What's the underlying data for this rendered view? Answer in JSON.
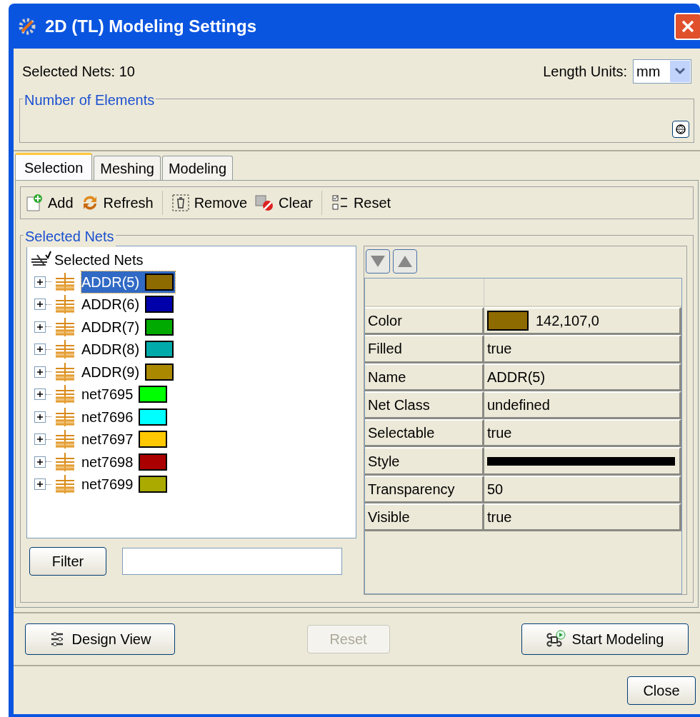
{
  "window": {
    "title": "2D (TL) Modeling Settings"
  },
  "selected_nets_label": "Selected Nets: 10",
  "length_units": {
    "label": "Length Units:",
    "value": "mm"
  },
  "number_of_elements": {
    "legend": "Number of Elements"
  },
  "tabs": [
    {
      "label": "Selection",
      "selected": true
    },
    {
      "label": "Meshing",
      "selected": false
    },
    {
      "label": "Modeling",
      "selected": false
    }
  ],
  "toolbar": [
    {
      "label": "Add",
      "kind": "add"
    },
    {
      "label": "Refresh",
      "kind": "refresh"
    },
    {
      "label": "Remove",
      "kind": "remove",
      "separator_before": true
    },
    {
      "label": "Clear",
      "kind": "clear"
    },
    {
      "label": "Reset",
      "kind": "reset",
      "separator_before": true
    }
  ],
  "selected_nets_group": {
    "legend": "Selected Nets"
  },
  "tree": {
    "root": "Selected Nets",
    "items": [
      {
        "label": "ADDR(5)",
        "color": "#8e6b00",
        "selected": true
      },
      {
        "label": "ADDR(6)",
        "color": "#0000aa",
        "selected": false
      },
      {
        "label": "ADDR(7)",
        "color": "#00aa00",
        "selected": false
      },
      {
        "label": "ADDR(8)",
        "color": "#00aaaa",
        "selected": false
      },
      {
        "label": "ADDR(9)",
        "color": "#aa8800",
        "selected": false
      },
      {
        "label": "net7695",
        "color": "#00ff00",
        "selected": false
      },
      {
        "label": "net7696",
        "color": "#00ffff",
        "selected": false
      },
      {
        "label": "net7697",
        "color": "#ffc800",
        "selected": false
      },
      {
        "label": "net7698",
        "color": "#aa0000",
        "selected": false
      },
      {
        "label": "net7699",
        "color": "#aaaa00",
        "selected": false
      }
    ]
  },
  "filter": {
    "button": "Filter"
  },
  "properties": [
    {
      "name": "Color",
      "kind": "color",
      "color": "#8e6b00",
      "value": "142,107,0"
    },
    {
      "name": "Filled",
      "kind": "text",
      "value": "true"
    },
    {
      "name": "Name",
      "kind": "text",
      "value": "ADDR(5)"
    },
    {
      "name": "Net Class",
      "kind": "text",
      "value": "undefined"
    },
    {
      "name": "Selectable",
      "kind": "text",
      "value": "true"
    },
    {
      "name": "Style",
      "kind": "line"
    },
    {
      "name": "Transparency",
      "kind": "text",
      "value": "50"
    },
    {
      "name": "Visible",
      "kind": "text",
      "value": "true"
    }
  ],
  "actions": [
    {
      "label": "Design View",
      "kind": "design",
      "disabled": false
    },
    {
      "label": "Reset",
      "kind": "plain",
      "disabled": true
    },
    {
      "label": "Start Modeling",
      "kind": "start",
      "disabled": false
    }
  ],
  "close_button": "Close"
}
